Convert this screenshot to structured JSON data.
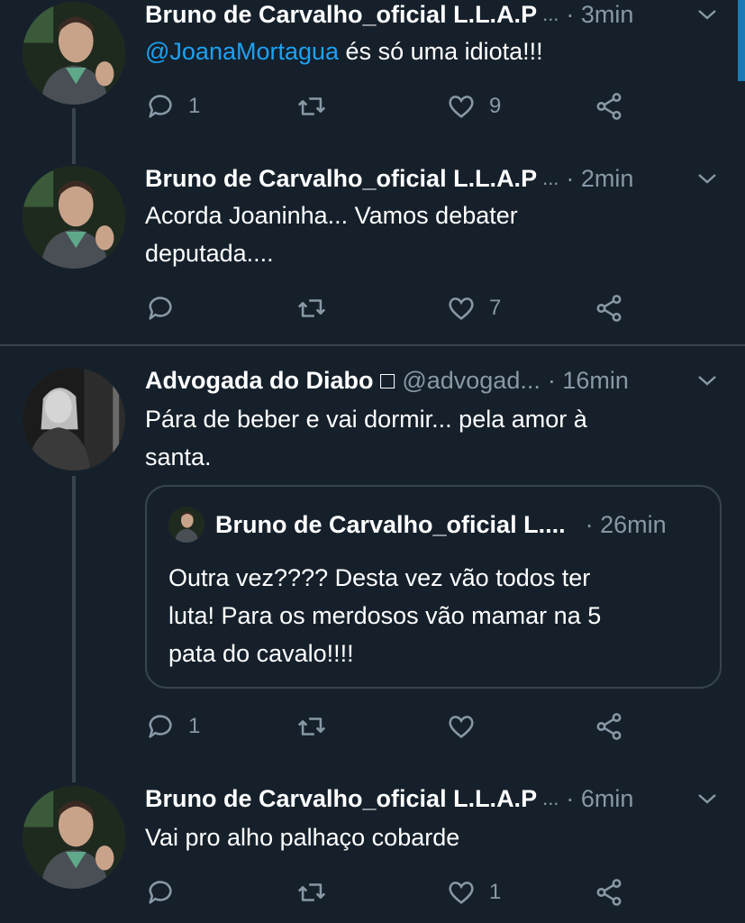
{
  "tweets": [
    {
      "name": "Bruno de Carvalho_oficial L.L.A.P",
      "ellipsis": "...",
      "time": "· 3min",
      "mention": "@JoanaMortagua",
      "text": " és só uma idiota!!!",
      "reply_count": "1",
      "like_count": "9"
    },
    {
      "name": "Bruno de Carvalho_oficial L.L.A.P",
      "ellipsis": "...",
      "time": "· 2min",
      "text_line1": "Acorda Joaninha... Vamos debater",
      "text_line2": "deputada....",
      "like_count": "7"
    },
    {
      "name": "Advogada do Diabo □",
      "handle": "@advogad...",
      "time": "· 16min",
      "text_line1": "Pára de beber e vai dormir... pela amor à",
      "text_line2": "santa.",
      "reply_count": "1",
      "quote": {
        "name": "Bruno de Carvalho_oficial L....",
        "time": "· 26min",
        "line1": "Outra vez???? Desta vez vão todos ter",
        "line2": "luta! Para os merdosos vão mamar na 5",
        "line3": "pata do cavalo!!!!"
      }
    },
    {
      "name": "Bruno de Carvalho_oficial L.L.A.P",
      "ellipsis": "...",
      "time": "· 6min",
      "text": "Vai pro alho palhaço cobarde",
      "like_count": "1"
    }
  ],
  "colors": {
    "background": "#15202b",
    "accent": "#1da1f2",
    "secondary": "#8899a6",
    "divider": "#38444d"
  },
  "icons": [
    "reply-icon",
    "retweet-icon",
    "like-icon",
    "share-icon",
    "chevron-down-icon"
  ]
}
